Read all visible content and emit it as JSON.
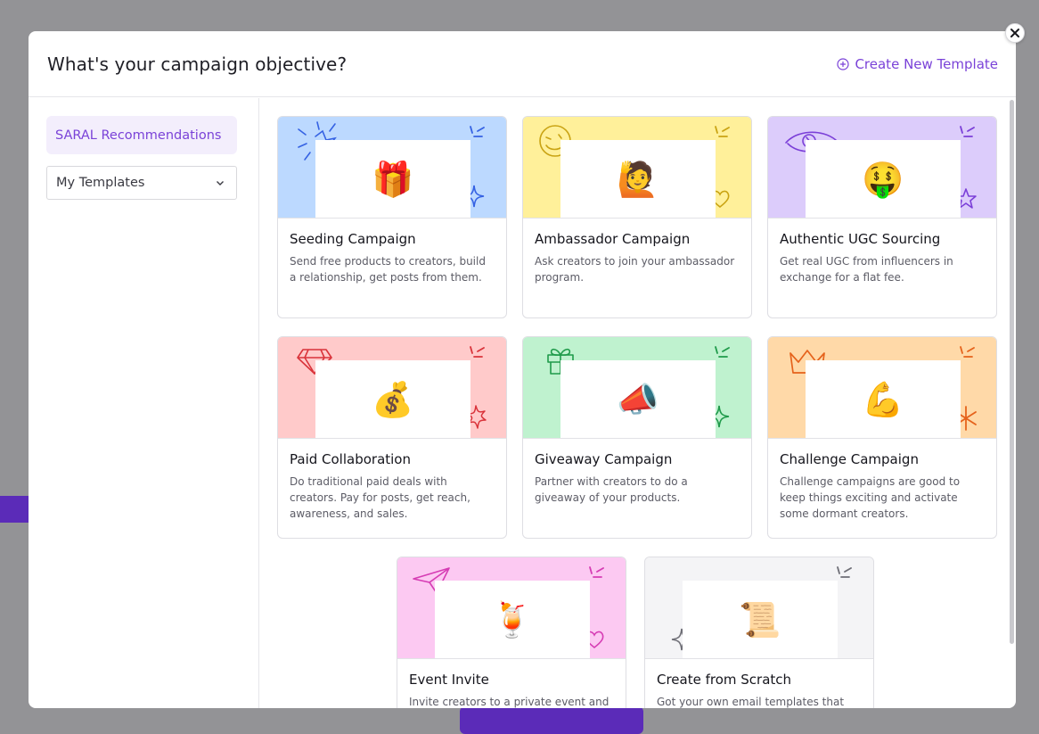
{
  "modal": {
    "title": "What's your campaign objective?",
    "create_template_label": "Create New Template"
  },
  "sidebar": {
    "recommendations_label": "SARAL Recommendations",
    "templates_select_value": "My Templates"
  },
  "cards": [
    {
      "title": "Seeding Campaign",
      "description": "Send free products to creators, build a relationship, get posts from them.",
      "emoji": "🎁",
      "bg": "#bcd9ff",
      "accent": "#3562e3"
    },
    {
      "title": "Ambassador Campaign",
      "description": "Ask creators to join your ambassador program.",
      "emoji": "🙋",
      "bg": "#fff09a",
      "accent": "#c9a313"
    },
    {
      "title": "Authentic UGC Sourcing",
      "description": "Get real UGC from influencers in exchange for a flat fee.",
      "emoji": "🤑",
      "bg": "#dcccfb",
      "accent": "#7b3fd8"
    },
    {
      "title": "Paid Collaboration",
      "description": "Do traditional paid deals with creators. Pay for posts, get reach, awareness, and sales.",
      "emoji": "💰",
      "bg": "#ffcaca",
      "accent": "#d9333a"
    },
    {
      "title": "Giveaway Campaign",
      "description": "Partner with creators to do a giveaway of your products.",
      "emoji": "📣",
      "bg": "#bff2cf",
      "accent": "#1f9a4a"
    },
    {
      "title": "Challenge Campaign",
      "description": "Challenge campaigns are good to keep things exciting and activate some dormant creators.",
      "emoji": "💪",
      "bg": "#ffd9a8",
      "accent": "#e5621b"
    },
    {
      "title": "Event Invite",
      "description": "Invite creators to a private event and",
      "emoji": "🍹",
      "bg": "#fcc9f2",
      "accent": "#d63cb4"
    },
    {
      "title": "Create from Scratch",
      "description": "Got your own email templates that",
      "emoji": "📜",
      "bg": "#f4f4f6",
      "accent": "#6e6e76"
    }
  ]
}
